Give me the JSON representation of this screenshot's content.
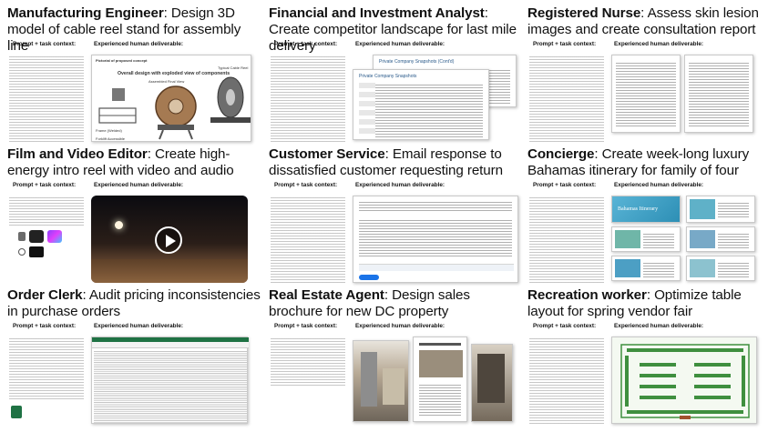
{
  "labels": {
    "prompt": "Prompt + task context:",
    "deliverable": "Experienced human deliverable:"
  },
  "cards": [
    {
      "role": "Manufacturing Engineer",
      "task": "Design 3D model of cable reel stand for assembly line",
      "inner": {
        "heading": "Pictorial of proposed concept",
        "view_title": "Overall design with exploded view of components",
        "assembled": "Assembled Final View",
        "reel": "Typical Cable Reel",
        "frame": "Frame (Welded)",
        "forklift": "Forklift Accessible"
      }
    },
    {
      "role": "Financial and Investment Analyst",
      "task": "Create competitor landscape for last mile delivery",
      "inner": {
        "sheet_title": "Private Company Snapshots",
        "sheet_title_back": "Private Company Snapshots (Cont'd)"
      }
    },
    {
      "role": "Registered Nurse",
      "task": "Assess skin lesion images and create consultation report",
      "inner": {}
    },
    {
      "role": "Film and Video Editor",
      "task": "Create high-energy intro reel with video and audio",
      "inner": {}
    },
    {
      "role": "Customer Service",
      "task": "Email response to dissatisfied customer requesting return",
      "inner": {}
    },
    {
      "role": "Concierge",
      "task": "Create week-long luxury Bahamas itinerary for family of four",
      "inner": {
        "slide_title": "Bahamas Itinerary"
      }
    },
    {
      "role": "Order Clerk",
      "task": "Audit pricing inconsistencies in purchase orders",
      "inner": {}
    },
    {
      "role": "Real Estate Agent",
      "task": "Design sales brochure for new DC property",
      "inner": {}
    },
    {
      "role": "Recreation worker",
      "task": "Optimize table layout for spring vendor fair",
      "inner": {}
    }
  ],
  "colors": {
    "excel_green": "#1f7244",
    "teal": "#2d8fb5",
    "garden_green": "#3f8f3f",
    "video_bg": "#2b1e17"
  }
}
